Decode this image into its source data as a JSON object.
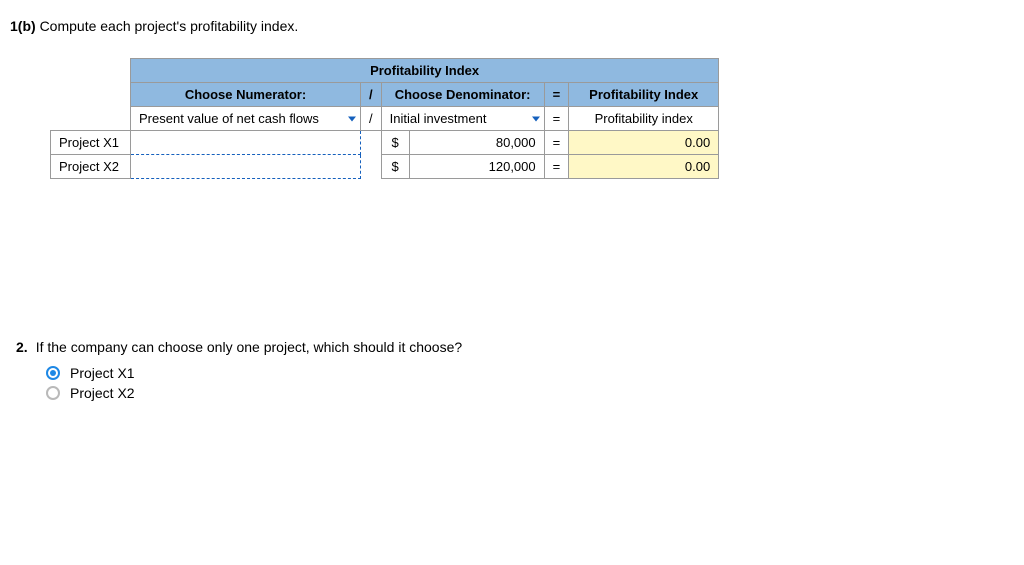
{
  "q1": {
    "label": "1(b)",
    "text": "Compute each project's profitability index."
  },
  "table": {
    "title": "Profitability Index",
    "headers": {
      "numerator": "Choose Numerator:",
      "slash": "/",
      "denominator": "Choose Denominator:",
      "eq": "=",
      "result": "Profitability Index"
    },
    "subheaders": {
      "numerator": "Present value of net cash flows",
      "slash": "/",
      "denominator": "Initial investment",
      "eq": "=",
      "result": "Profitability index"
    },
    "rows": [
      {
        "project": "Project X1",
        "numerator": "",
        "currency": "$",
        "denominator": "80,000",
        "eq": "=",
        "result": "0.00"
      },
      {
        "project": "Project X2",
        "numerator": "",
        "currency": "$",
        "denominator": "120,000",
        "eq": "=",
        "result": "0.00"
      }
    ]
  },
  "q2": {
    "label": "2.",
    "text": "If the company can choose only one project, which should it choose?",
    "options": [
      {
        "label": "Project X1",
        "selected": true
      },
      {
        "label": "Project X2",
        "selected": false
      }
    ]
  }
}
